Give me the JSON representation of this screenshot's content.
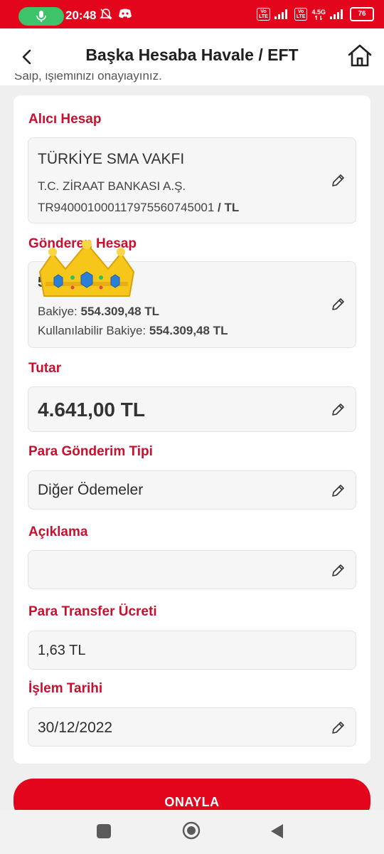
{
  "status_bar": {
    "time": "20:48",
    "network_label": "4.5G",
    "battery": "76",
    "volte_1": "Vo\nLTE",
    "volte_2": "Vo\nLTE"
  },
  "header": {
    "title": "Başka Hesaba Havale / EFT",
    "partial_text": "Saip, işleminizi onaylayınız."
  },
  "recipient": {
    "label": "Alıcı Hesap",
    "name": "TÜRKİYE SMA VAKFI",
    "bank": "T.C. ZİRAAT BANKASI A.Ş.",
    "iban": "TR940001000117975560745001",
    "currency_sep": " / ",
    "currency": "TL"
  },
  "sender": {
    "label": "Gönderen Hesap",
    "account_suffix": "5002",
    "account_type": "Vadesiz",
    "balance_label": "Bakiye:",
    "balance_value": "554.309,48 TL",
    "available_label": "Kullanılabilir Bakiye:",
    "available_value": "554.309,48 TL"
  },
  "amount": {
    "label": "Tutar",
    "value": "4.641,00 TL"
  },
  "transfer_type": {
    "label": "Para Gönderim Tipi",
    "value": "Diğer Ödemeler"
  },
  "description": {
    "label": "Açıklama",
    "value": ""
  },
  "fee": {
    "label": "Para Transfer Ücreti",
    "value": "1,63 TL"
  },
  "date": {
    "label": "İşlem Tarihi",
    "value": "30/12/2022"
  },
  "confirm_button": "ONAYLA",
  "colors": {
    "brand_red": "#e3051b",
    "label_red": "#c8102e",
    "mic_green": "#3dc46a"
  },
  "icons": [
    "mic-icon",
    "mute-bell-icon",
    "discord-icon",
    "signal-icon",
    "battery-icon",
    "back-arrow-icon",
    "home-icon",
    "pencil-icon",
    "crown-emoji-icon",
    "recents-icon",
    "nav-home-icon",
    "nav-back-icon"
  ]
}
